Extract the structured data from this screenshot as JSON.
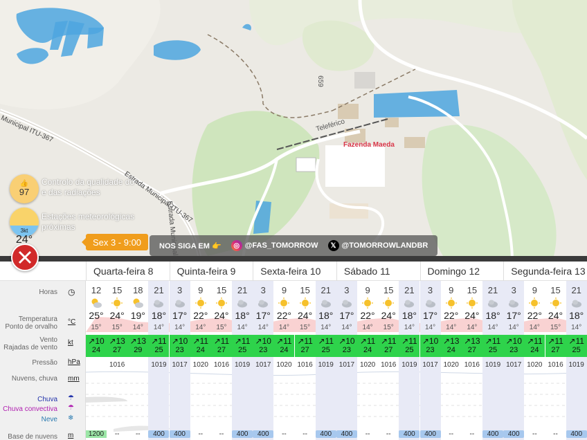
{
  "map": {
    "places": {
      "fazenda": "Fazenda Maeda",
      "teleferico": "Teleférico",
      "road_number": "659"
    },
    "roads": {
      "road_1": "Estrada Municipal ITU-367",
      "road_2": "Estrada Municipal ITU-367",
      "road_3": "Estrada Municipal ITU-367"
    }
  },
  "overlay": {
    "quality_score": "97",
    "quality_text_1": "Controlo da qualidade do",
    "quality_text_2": "e das radiações",
    "station_temp": "24°",
    "station_wind": "3kt",
    "station_text_1": "Estações meteorológicas",
    "station_text_2": "próximas",
    "time_pill": "Sex 3 - 9:00",
    "follow_label": "NOS SIGA EM 👉",
    "instagram": "@FAS_TOMORROW",
    "x_handle": "@TOMORROWLANDBR"
  },
  "forecast": {
    "days": [
      "Quarta-feira 8",
      "Quinta-feira 9",
      "Sexta-feira 10",
      "Sábado 11",
      "Domingo 12",
      "Segunda-feira 13"
    ],
    "labels": {
      "hours": "Horas",
      "temp": "Temperatura",
      "dew": "Ponto de orvalho",
      "wind": "Vento",
      "gust": "Rajadas de vento",
      "pressure": "Pressão",
      "clouds": "Nuvens, chuva",
      "rain": "Chuva",
      "conv": "Chuva convectiva",
      "snow": "Neve",
      "cloudbase": "Base de nuvens"
    },
    "units": {
      "temp": "°C",
      "wind": "kt",
      "pressure": "hPa",
      "clouds": "mm",
      "cloudbase": "m"
    },
    "columns": [
      {
        "h": "12",
        "t": "25°",
        "d": "15°",
        "w": "10",
        "g": "24",
        "p": "",
        "cb": "1200",
        "n": false,
        "ico": "pc"
      },
      {
        "h": "15",
        "t": "24°",
        "d": "15°",
        "w": "13",
        "g": "27",
        "p": "1016",
        "cb": "--",
        "n": false,
        "ico": "sun"
      },
      {
        "h": "18",
        "t": "19°",
        "d": "14°",
        "w": "13",
        "g": "29",
        "p": "",
        "cb": "--",
        "n": false,
        "ico": "pc"
      },
      {
        "h": "21",
        "t": "18°",
        "d": "14°",
        "w": "11",
        "g": "25",
        "p": "1019",
        "cb": "400",
        "n": true,
        "ico": "cloud"
      },
      {
        "h": "3",
        "t": "17°",
        "d": "14°",
        "w": "10",
        "g": "23",
        "p": "1017",
        "cb": "400",
        "n": true,
        "ico": "cloud"
      },
      {
        "h": "9",
        "t": "22°",
        "d": "14°",
        "w": "11",
        "g": "24",
        "p": "1020",
        "cb": "--",
        "n": false,
        "ico": "sun"
      },
      {
        "h": "15",
        "t": "24°",
        "d": "15°",
        "w": "11",
        "g": "27",
        "p": "1016",
        "cb": "--",
        "n": false,
        "ico": "sun"
      },
      {
        "h": "21",
        "t": "18°",
        "d": "14°",
        "w": "11",
        "g": "25",
        "p": "1019",
        "cb": "400",
        "n": true,
        "ico": "cloud"
      },
      {
        "h": "3",
        "t": "17°",
        "d": "14°",
        "w": "10",
        "g": "23",
        "p": "1017",
        "cb": "400",
        "n": true,
        "ico": "cloud"
      },
      {
        "h": "9",
        "t": "22°",
        "d": "14°",
        "w": "11",
        "g": "24",
        "p": "1020",
        "cb": "--",
        "n": false,
        "ico": "sun"
      },
      {
        "h": "15",
        "t": "24°",
        "d": "15°",
        "w": "11",
        "g": "27",
        "p": "1016",
        "cb": "--",
        "n": false,
        "ico": "sun"
      },
      {
        "h": "21",
        "t": "18°",
        "d": "14°",
        "w": "11",
        "g": "25",
        "p": "1019",
        "cb": "400",
        "n": true,
        "ico": "cloud"
      },
      {
        "h": "3",
        "t": "17°",
        "d": "14°",
        "w": "10",
        "g": "23",
        "p": "1017",
        "cb": "400",
        "n": true,
        "ico": "cloud"
      },
      {
        "h": "9",
        "t": "22°",
        "d": "14°",
        "w": "11",
        "g": "24",
        "p": "1020",
        "cb": "--",
        "n": false,
        "ico": "sun"
      },
      {
        "h": "15",
        "t": "24°",
        "d": "15°",
        "w": "11",
        "g": "27",
        "p": "1016",
        "cb": "--",
        "n": false,
        "ico": "sun"
      },
      {
        "h": "21",
        "t": "18°",
        "d": "14°",
        "w": "11",
        "g": "25",
        "p": "1019",
        "cb": "400",
        "n": true,
        "ico": "cloud"
      },
      {
        "h": "3",
        "t": "17°",
        "d": "14°",
        "w": "10",
        "g": "23",
        "p": "1017",
        "cb": "400",
        "n": true,
        "ico": "cloud"
      },
      {
        "h": "9",
        "t": "22°",
        "d": "14°",
        "w": "13",
        "g": "24",
        "p": "1020",
        "cb": "--",
        "n": false,
        "ico": "sun"
      },
      {
        "h": "15",
        "t": "24°",
        "d": "14°",
        "w": "13",
        "g": "27",
        "p": "1016",
        "cb": "--",
        "n": false,
        "ico": "sun"
      },
      {
        "h": "21",
        "t": "18°",
        "d": "14°",
        "w": "11",
        "g": "25",
        "p": "1019",
        "cb": "400",
        "n": true,
        "ico": "cloud"
      },
      {
        "h": "3",
        "t": "17°",
        "d": "14°",
        "w": "10",
        "g": "23",
        "p": "1017",
        "cb": "400",
        "n": true,
        "ico": "cloud"
      },
      {
        "h": "9",
        "t": "22°",
        "d": "14°",
        "w": "11",
        "g": "24",
        "p": "1020",
        "cb": "--",
        "n": false,
        "ico": "sun"
      },
      {
        "h": "15",
        "t": "24°",
        "d": "15°",
        "w": "11",
        "g": "27",
        "p": "1016",
        "cb": "--",
        "n": false,
        "ico": "sun"
      },
      {
        "h": "21",
        "t": "18°",
        "d": "14°",
        "w": "11",
        "g": "25",
        "p": "1019",
        "cb": "400",
        "n": true,
        "ico": "cloud"
      }
    ],
    "colors": {
      "wind_green": "#2ed34b",
      "night_band": "#e8eaf6",
      "accent_orange": "#f09d1c"
    }
  }
}
